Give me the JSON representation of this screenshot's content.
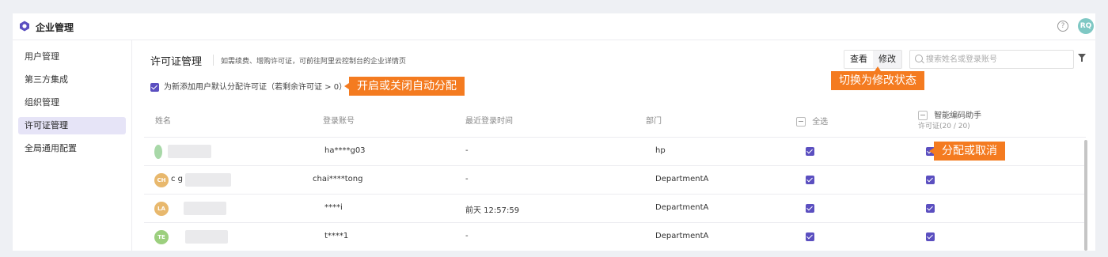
{
  "app": {
    "title": "企业管理",
    "user_initials": "RQ",
    "accent": "#5b4fc0",
    "avatar_color": "#7fc8c4"
  },
  "sidebar": {
    "items": [
      {
        "label": "用户管理",
        "active": false
      },
      {
        "label": "第三方集成",
        "active": false
      },
      {
        "label": "组织管理",
        "active": false
      },
      {
        "label": "许可证管理",
        "active": true
      },
      {
        "label": "全局通用配置",
        "active": false
      }
    ]
  },
  "header": {
    "title": "许可证管理",
    "description": "如需续费、增购许可证，可前往阿里云控制台的企业详情页",
    "view_label": "查看",
    "edit_label": "修改",
    "search_placeholder": "搜索姓名或登录账号"
  },
  "default_assign": {
    "label": "为新添加用户默认分配许可证（若剩余许可证 > 0）",
    "checked": true
  },
  "callouts": {
    "auto_assign": "开启或关闭自动分配",
    "switch_mode": "切换为修改状态",
    "assign_toggle": "分配或取消",
    "color": "#f47b20"
  },
  "table": {
    "headers": {
      "name": "姓名",
      "account": "登录账号",
      "last_login": "最近登录时间",
      "department": "部门",
      "select_all": "全选",
      "assistant": "智能编码助手",
      "license_count": "许可证(20 / 20)"
    },
    "rows": [
      {
        "initials": "",
        "avatar_color": "#a8d8a8",
        "name_suffix": "",
        "account": "ha****g03",
        "last_login": "-",
        "department": "hp",
        "checked": true,
        "assigned": true
      },
      {
        "initials": "CH",
        "avatar_color": "#e8b86d",
        "name_suffix": "c                g",
        "account": "chai****tong",
        "last_login": "-",
        "department": "DepartmentA",
        "checked": true,
        "assigned": true
      },
      {
        "initials": "LA",
        "avatar_color": "#e8b86d",
        "name_suffix": "",
        "account": "****i",
        "last_login": "前天 12:57:59",
        "department": "DepartmentA",
        "checked": true,
        "assigned": true
      },
      {
        "initials": "TE",
        "avatar_color": "#9ccf7e",
        "name_suffix": "",
        "account": "t****1",
        "last_login": "-",
        "department": "DepartmentA",
        "checked": true,
        "assigned": true
      }
    ]
  }
}
